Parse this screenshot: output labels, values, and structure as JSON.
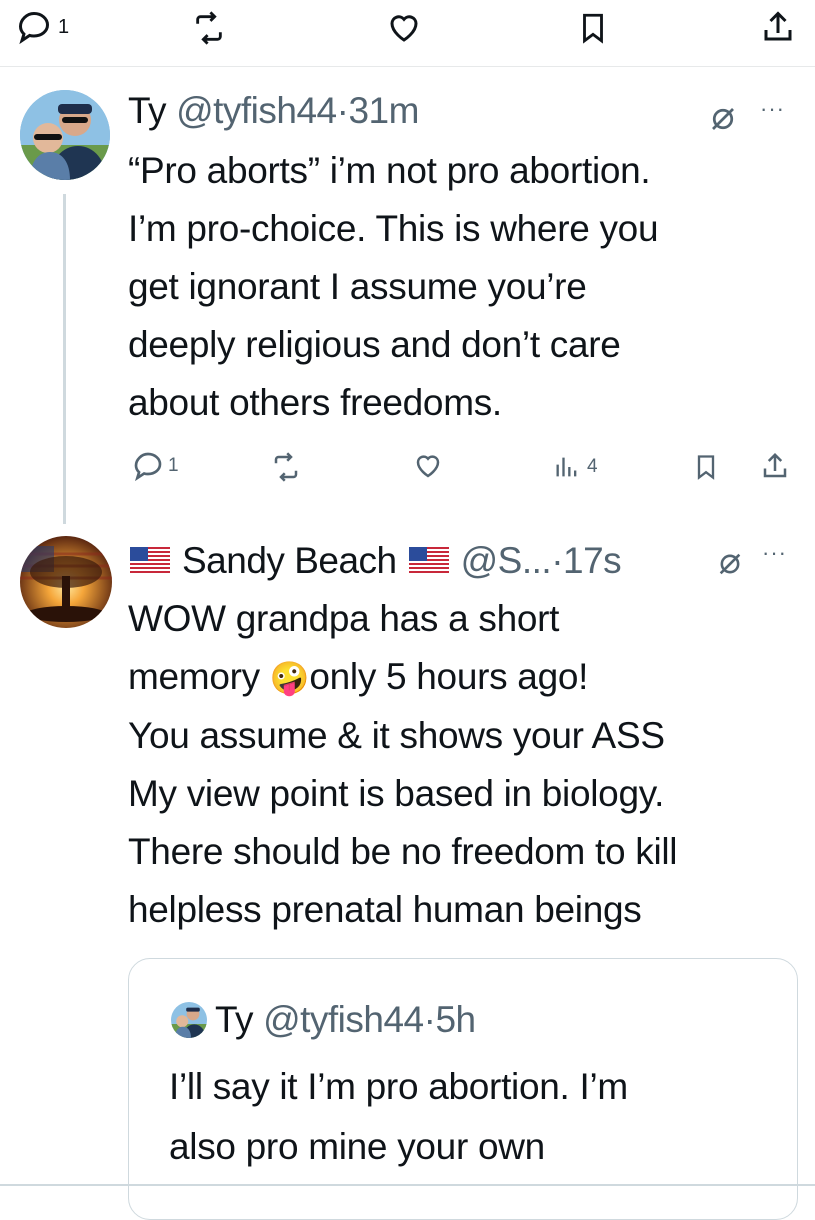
{
  "top_actions": {
    "reply_count": "1",
    "icons": [
      "reply-icon",
      "retweet-icon",
      "like-icon",
      "bookmark-icon",
      "share-icon"
    ]
  },
  "tweet1": {
    "name": "Ty",
    "handle": "@tyfish44",
    "separator": "·",
    "time": "31m",
    "lines": [
      "“Pro aborts” i’m not pro abortion.",
      "I’m pro-choice. This is where you",
      "get ignorant I assume you’re",
      "deeply religious and don’t care",
      "about others freedoms."
    ],
    "reply_count": "1",
    "views_count": "4"
  },
  "tweet2": {
    "name": "Sandy Beach",
    "handle": "@S...",
    "separator": "·",
    "time": "17s",
    "lines": [
      "WOW grandpa has a short",
      "memory",
      "only 5 hours ago!",
      "You assume & it shows your ASS",
      "My view point is based in biology.",
      "There should be no freedom to kill",
      "helpless prenatal human beings"
    ],
    "emoji": "🤪"
  },
  "quote": {
    "name": "Ty",
    "handle": "@tyfish44",
    "separator": "·",
    "time": "5h",
    "lines": [
      "I’ll say it I’m pro abortion. I’m",
      "also pro mine your own"
    ]
  },
  "colors": {
    "text": "#0f1419",
    "secondary": "#536471",
    "border": "#cfd9de",
    "divider": "#e7e9ea"
  }
}
